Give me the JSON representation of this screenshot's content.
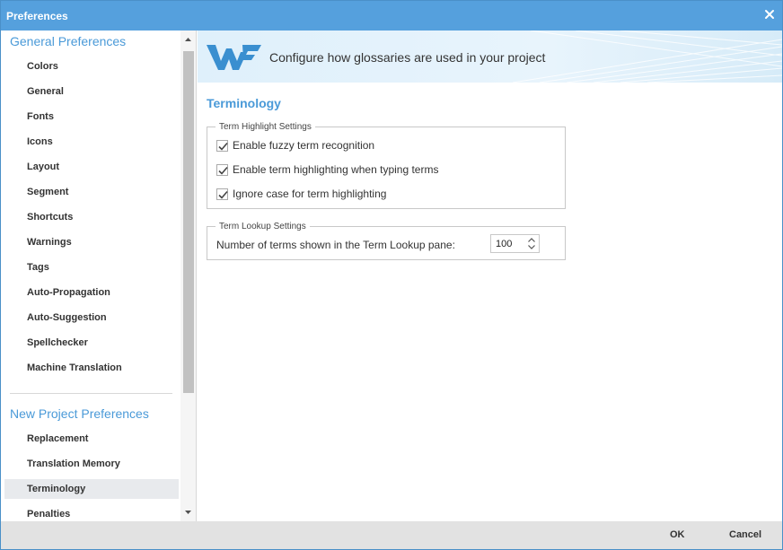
{
  "window": {
    "title": "Preferences",
    "close_icon": "close-icon"
  },
  "sidebar": {
    "general_title": "General Preferences",
    "general_items": [
      "Colors",
      "General",
      "Fonts",
      "Icons",
      "Layout",
      "Segment",
      "Shortcuts",
      "Warnings",
      "Tags",
      "Auto-Propagation",
      "Auto-Suggestion",
      "Spellchecker",
      "Machine Translation"
    ],
    "project_title": "New Project Preferences",
    "project_items": [
      "Replacement",
      "Translation Memory",
      "Terminology",
      "Penalties"
    ],
    "selected_item": "Terminology"
  },
  "banner": {
    "logo_icon": "wf-logo-icon",
    "tagline": "Configure how glossaries are used in your project"
  },
  "main": {
    "section_title": "Terminology",
    "highlight_group": {
      "legend": "Term Highlight Settings",
      "options": [
        {
          "label": "Enable fuzzy term recognition",
          "checked": true
        },
        {
          "label": "Enable term highlighting when typing terms",
          "checked": true
        },
        {
          "label": "Ignore case for term highlighting",
          "checked": true
        }
      ]
    },
    "lookup_group": {
      "legend": "Term Lookup Settings",
      "label": "Number of terms shown in the Term Lookup pane:",
      "value": "100"
    }
  },
  "footer": {
    "ok_label": "OK",
    "cancel_label": "Cancel"
  },
  "colors": {
    "titlebar": "#55a0dd",
    "accent": "#4a9ad8",
    "footer": "#e2e2e2"
  }
}
